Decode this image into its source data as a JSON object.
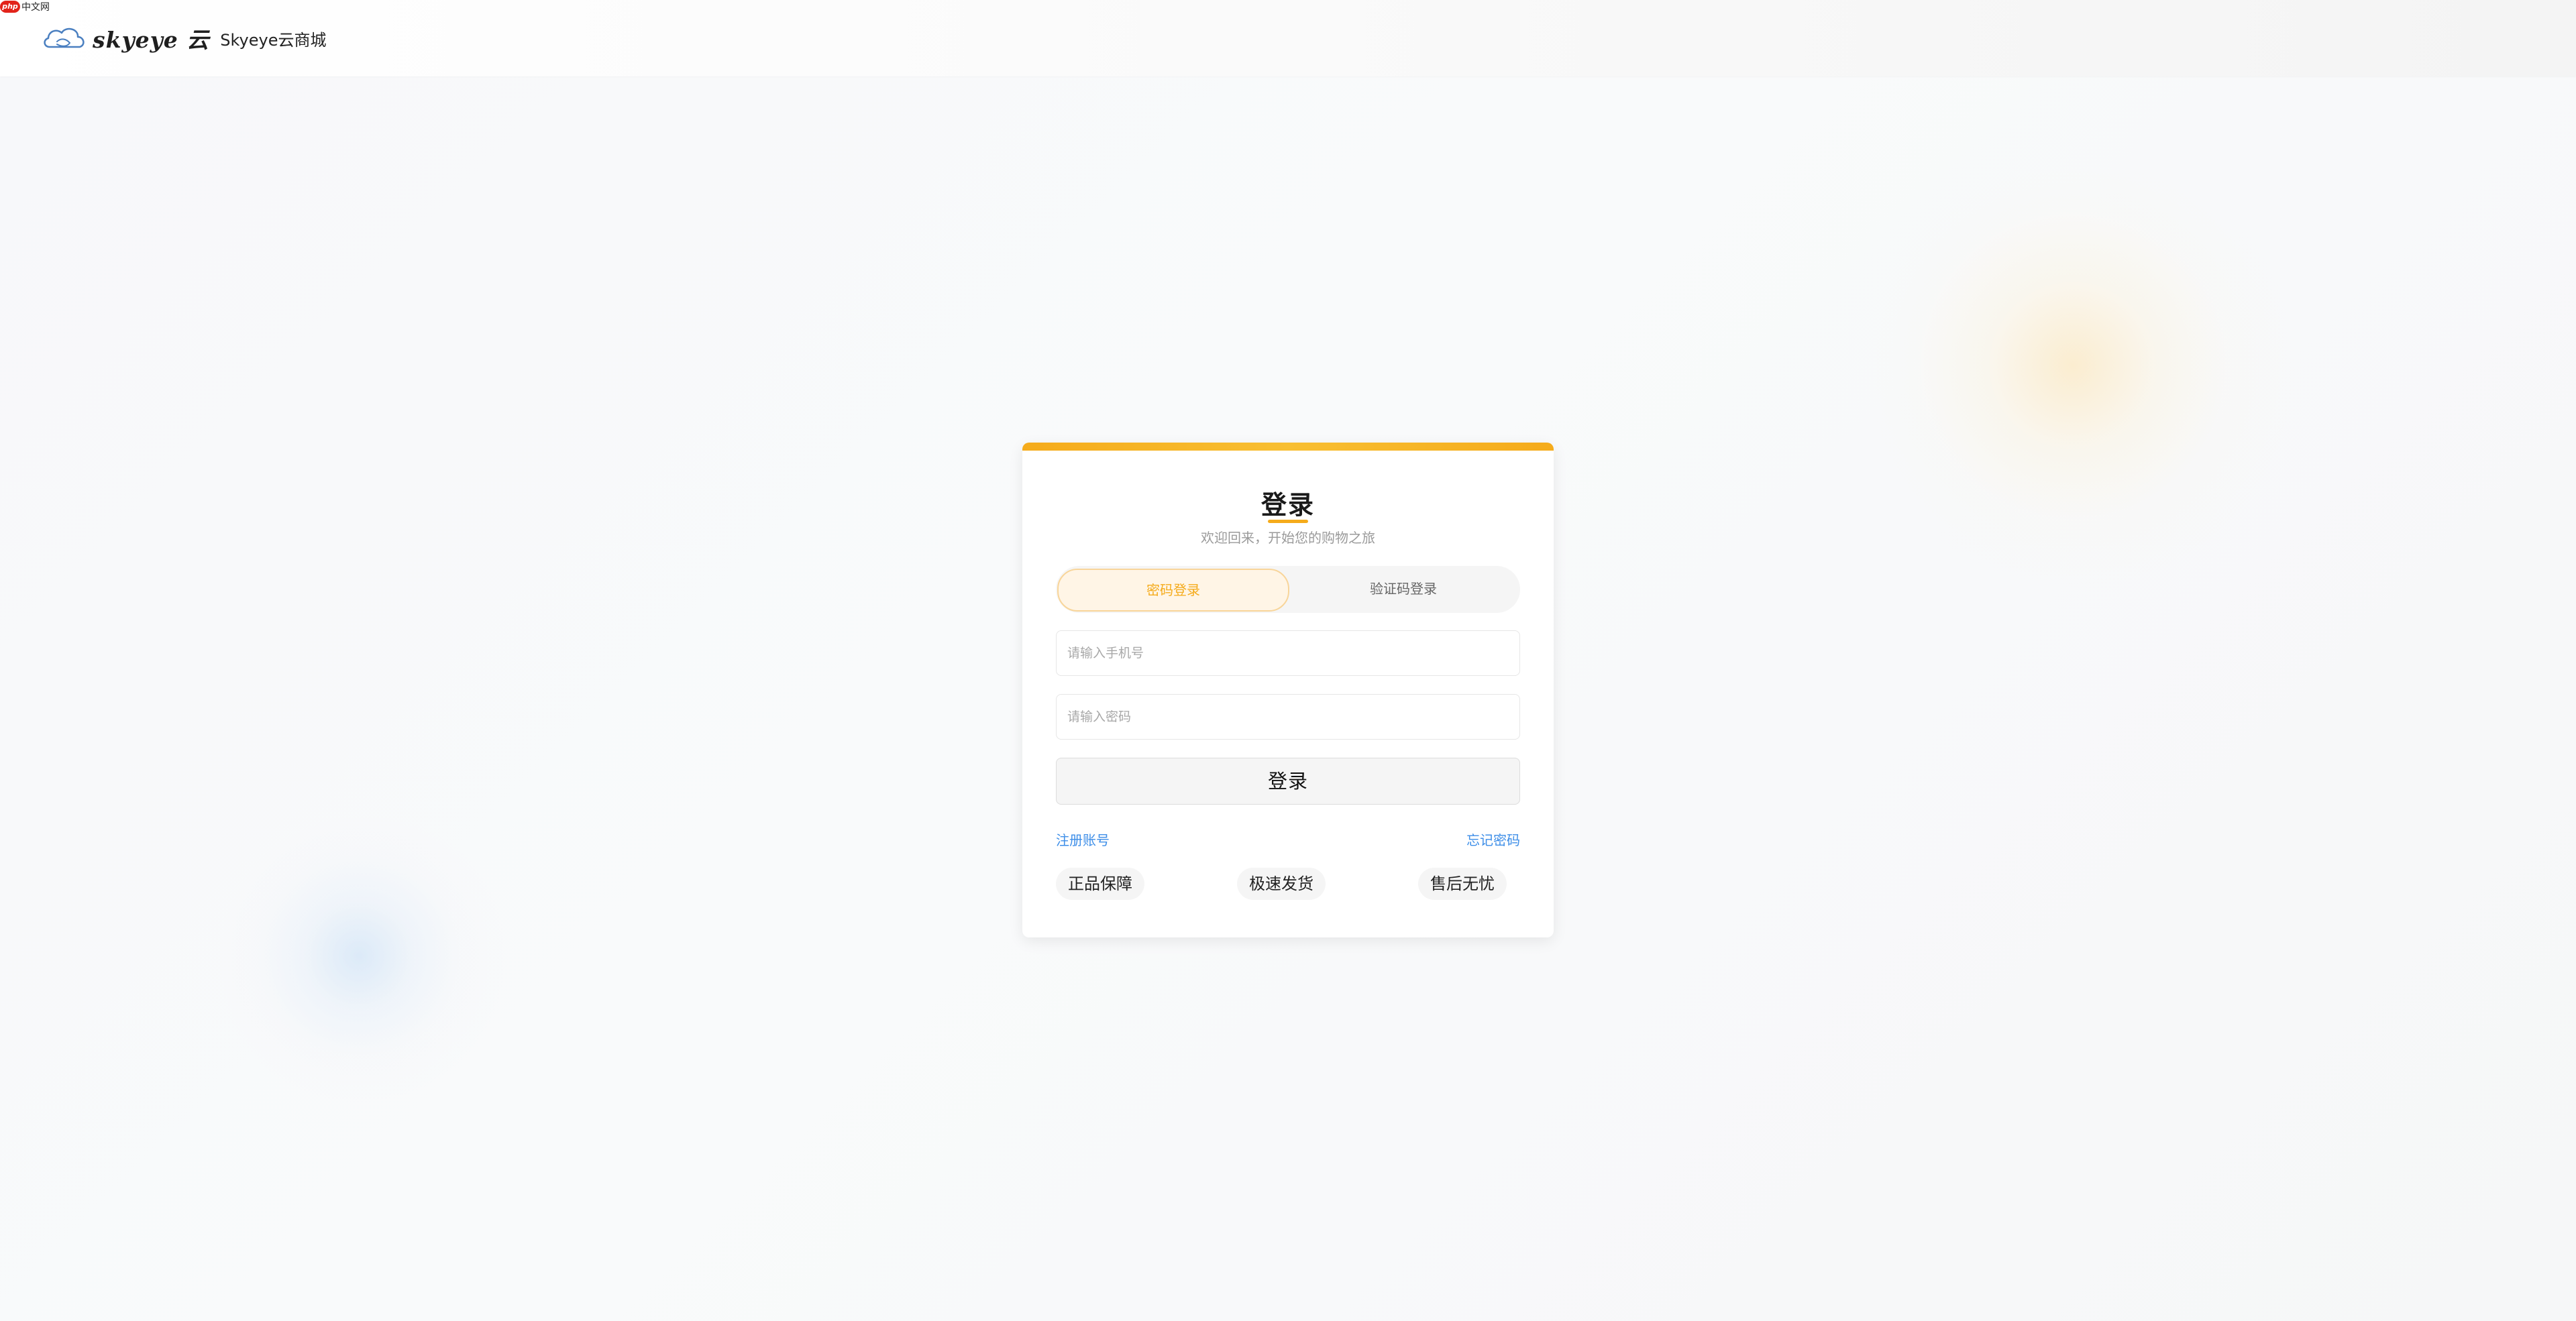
{
  "watermark": {
    "badge": "php",
    "text": "中文网"
  },
  "header": {
    "brand_script": "skyeye 云",
    "brand_name": "Skyeye云商城"
  },
  "card": {
    "title": "登录",
    "subtitle": "欢迎回来，开始您的购物之旅",
    "tabs": [
      {
        "label": "密码登录",
        "active": true
      },
      {
        "label": "验证码登录",
        "active": false
      }
    ],
    "phone_placeholder": "请输入手机号",
    "password_placeholder": "请输入密码",
    "login_button": "登录",
    "register_link": "注册账号",
    "forgot_link": "忘记密码",
    "features": [
      "正品保障",
      "极速发货",
      "售后无忧"
    ]
  },
  "colors": {
    "accent": "#f5ab1b",
    "link": "#3d8ee8"
  },
  "icons": {
    "logo": "cloud-icon"
  }
}
